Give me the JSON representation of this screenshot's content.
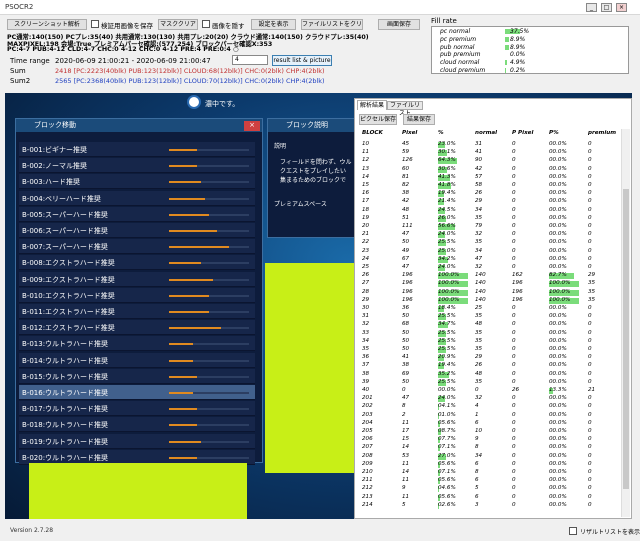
{
  "window": {
    "title": "PSOCR2",
    "min": "_",
    "max": "□",
    "close": "×"
  },
  "toolbar": {
    "analyze": "スクリーンショット解析",
    "save_verify": "検証用画像を保存",
    "mask_clear": "マスククリア",
    "hide_image": "画像を隠す",
    "show_settings": "設定を表示",
    "clear_filelist": "ファイルリストをクリア",
    "save_screen": "画面保存"
  },
  "info_lines": [
    "PC通常:140(150) PCプレ:35(40) 共用通常:130(130) 共用プレ:20(20) クラウド通常:140(150) クラウドプレ:35(40)",
    "MAXPIXEL:198 会場:True プレミアムパーセ確認:(577,254) ブロックパーセ確認X:353",
    "PC:4-7 PUB:4-12 CLD:4-7 CHC:0 4-12 CHC:0 4-12 PRE:4 PRE:0:4 ○"
  ],
  "time_range": {
    "label": "Time range",
    "value": "2020-06-09 21:00:21 - 2020-06-09 21:00:47",
    "input": "4",
    "button": "result list & picture"
  },
  "sum": {
    "label": "Sum",
    "value": "2418 [PC:2223(40blk) PUB:123(12blk)] CLOUD:68(12blk)] CHC:0(2blk) CHP:4(2blk)"
  },
  "sum2": {
    "label": "Sum2",
    "value": "2565 [PC:2368(40blk) PUB:123(12blk)] CLOUD:70(12blk)] CHC:0(2blk) CHP:4(2blk)"
  },
  "fill_rate": {
    "label": "Fill rate",
    "rows": [
      {
        "name": "pc normal",
        "pct": 37.5,
        "text": "37.5%"
      },
      {
        "name": "pc premium",
        "pct": 8.9,
        "text": "8.9%"
      },
      {
        "name": "pub normal",
        "pct": 8.9,
        "text": "8.9%"
      },
      {
        "name": "pub premium",
        "pct": 0.0,
        "text": "0.0%"
      },
      {
        "name": "cloud normal",
        "pct": 4.9,
        "text": "4.9%"
      },
      {
        "name": "cloud premium",
        "pct": 0.2,
        "text": "0.2%"
      }
    ]
  },
  "game": {
    "notice": "濃中です。",
    "block_panel_title": "ブロック移動",
    "desc_panel_title": "ブロック説明",
    "desc_header": "説明",
    "desc_text": [
      "フィールドを問わず、ウル",
      "クエストをプレイしたい",
      "集まるためのブロックで"
    ],
    "premium_space": "プレミアムスペース",
    "blocks": [
      {
        "label": "B-001:ビギナー推奨",
        "level": 0.35
      },
      {
        "label": "B-002:ノーマル推奨",
        "level": 0.35
      },
      {
        "label": "B-003:ハード推奨",
        "level": 0.4
      },
      {
        "label": "B-004:ベリーハード推奨",
        "level": 0.45
      },
      {
        "label": "B-005:スーパーハード推奨",
        "level": 0.5
      },
      {
        "label": "B-006:スーパーハード推奨",
        "level": 0.6
      },
      {
        "label": "B-007:スーパーハード推奨",
        "level": 0.75
      },
      {
        "label": "B-008:エクストラハード推奨",
        "level": 0.4
      },
      {
        "label": "B-009:エクストラハード推奨",
        "level": 0.55
      },
      {
        "label": "B-010:エクストラハード推奨",
        "level": 0.5
      },
      {
        "label": "B-011:エクストラハード推奨",
        "level": 0.5
      },
      {
        "label": "B-012:エクストラハード推奨",
        "level": 0.65
      },
      {
        "label": "B-013:ウルトラハード推奨",
        "level": 0.3
      },
      {
        "label": "B-014:ウルトラハード推奨",
        "level": 0.3
      },
      {
        "label": "B-015:ウルトラハード推奨",
        "level": 0.35
      },
      {
        "label": "B-016:ウルトラハード推奨",
        "level": 0.3
      },
      {
        "label": "B-017:ウルトラハード推奨",
        "level": 0.35
      },
      {
        "label": "B-018:ウルトラハード推奨",
        "level": 0.35
      },
      {
        "label": "B-019:ウルトラハード推奨",
        "level": 0.4
      },
      {
        "label": "B-020:ウルトラハード推奨",
        "level": 0.35
      }
    ]
  },
  "results": {
    "tabs": [
      "解析結果",
      "ファイルリスト"
    ],
    "btn_save_pixel": "ピクセル保存",
    "btn_save_result": "結果保存",
    "headers": [
      "BLOCK",
      "Pixel",
      "%",
      "normal",
      "P Pixel",
      "P%",
      "premium"
    ],
    "rows": [
      [
        "10",
        "45",
        "23.0%",
        "31",
        "0",
        "00.0%",
        "0"
      ],
      [
        "11",
        "59",
        "30.1%",
        "41",
        "0",
        "00.0%",
        "0"
      ],
      [
        "12",
        "126",
        "64.3%",
        "90",
        "0",
        "00.0%",
        "0"
      ],
      [
        "13",
        "60",
        "30.6%",
        "42",
        "0",
        "00.0%",
        "0"
      ],
      [
        "14",
        "81",
        "41.3%",
        "57",
        "0",
        "00.0%",
        "0"
      ],
      [
        "15",
        "82",
        "41.8%",
        "58",
        "0",
        "00.0%",
        "0"
      ],
      [
        "16",
        "38",
        "19.4%",
        "26",
        "0",
        "00.0%",
        "0"
      ],
      [
        "17",
        "42",
        "21.4%",
        "29",
        "0",
        "00.0%",
        "0"
      ],
      [
        "18",
        "48",
        "24.5%",
        "34",
        "0",
        "00.0%",
        "0"
      ],
      [
        "19",
        "51",
        "26.0%",
        "35",
        "0",
        "00.0%",
        "0"
      ],
      [
        "20",
        "111",
        "56.6%",
        "79",
        "0",
        "00.0%",
        "0"
      ],
      [
        "21",
        "47",
        "24.0%",
        "32",
        "0",
        "00.0%",
        "0"
      ],
      [
        "22",
        "50",
        "25.5%",
        "35",
        "0",
        "00.0%",
        "0"
      ],
      [
        "23",
        "49",
        "25.0%",
        "34",
        "0",
        "00.0%",
        "0"
      ],
      [
        "24",
        "67",
        "34.2%",
        "47",
        "0",
        "00.0%",
        "0"
      ],
      [
        "25",
        "47",
        "24.0%",
        "32",
        "0",
        "00.0%",
        "0"
      ],
      [
        "26",
        "196",
        "100.0%",
        "140",
        "162",
        "82.7%",
        "29"
      ],
      [
        "27",
        "196",
        "100.0%",
        "140",
        "196",
        "100.0%",
        "35"
      ],
      [
        "28",
        "196",
        "100.0%",
        "140",
        "196",
        "100.0%",
        "35"
      ],
      [
        "29",
        "196",
        "100.0%",
        "140",
        "196",
        "100.0%",
        "35"
      ],
      [
        "30",
        "36",
        "18.4%",
        "25",
        "0",
        "00.0%",
        "0"
      ],
      [
        "31",
        "50",
        "25.5%",
        "35",
        "0",
        "00.0%",
        "0"
      ],
      [
        "32",
        "68",
        "34.7%",
        "48",
        "0",
        "00.0%",
        "0"
      ],
      [
        "33",
        "50",
        "25.5%",
        "35",
        "0",
        "00.0%",
        "0"
      ],
      [
        "34",
        "50",
        "25.5%",
        "35",
        "0",
        "00.0%",
        "0"
      ],
      [
        "35",
        "50",
        "25.5%",
        "35",
        "0",
        "00.0%",
        "0"
      ],
      [
        "36",
        "41",
        "20.9%",
        "29",
        "0",
        "00.0%",
        "0"
      ],
      [
        "37",
        "38",
        "19.4%",
        "26",
        "0",
        "00.0%",
        "0"
      ],
      [
        "38",
        "69",
        "35.2%",
        "48",
        "0",
        "00.0%",
        "0"
      ],
      [
        "39",
        "50",
        "25.5%",
        "35",
        "0",
        "00.0%",
        "0"
      ],
      [
        "40",
        "0",
        "00.0%",
        "0",
        "26",
        "13.3%",
        "21"
      ],
      [
        "201",
        "47",
        "24.0%",
        "32",
        "0",
        "00.0%",
        "0"
      ],
      [
        "202",
        "8",
        "04.1%",
        "4",
        "0",
        "00.0%",
        "0"
      ],
      [
        "203",
        "2",
        "01.0%",
        "1",
        "0",
        "00.0%",
        "0"
      ],
      [
        "204",
        "11",
        "05.6%",
        "6",
        "0",
        "00.0%",
        "0"
      ],
      [
        "205",
        "17",
        "08.7%",
        "10",
        "0",
        "00.0%",
        "0"
      ],
      [
        "206",
        "15",
        "07.7%",
        "9",
        "0",
        "00.0%",
        "0"
      ],
      [
        "207",
        "14",
        "07.1%",
        "8",
        "0",
        "00.0%",
        "0"
      ],
      [
        "208",
        "53",
        "27.0%",
        "34",
        "0",
        "00.0%",
        "0"
      ],
      [
        "209",
        "11",
        "05.6%",
        "6",
        "0",
        "00.0%",
        "0"
      ],
      [
        "210",
        "14",
        "07.1%",
        "8",
        "0",
        "00.0%",
        "0"
      ],
      [
        "211",
        "11",
        "05.6%",
        "6",
        "0",
        "00.0%",
        "0"
      ],
      [
        "212",
        "9",
        "04.6%",
        "5",
        "0",
        "00.0%",
        "0"
      ],
      [
        "213",
        "11",
        "05.6%",
        "6",
        "0",
        "00.0%",
        "0"
      ],
      [
        "214",
        "5",
        "02.6%",
        "3",
        "0",
        "00.0%",
        "0"
      ]
    ],
    "pct_values": [
      23.0,
      30.1,
      64.3,
      30.6,
      41.3,
      41.8,
      19.4,
      21.4,
      24.5,
      26.0,
      56.6,
      24.0,
      25.5,
      25.0,
      34.2,
      24.0,
      100,
      100,
      100,
      100,
      18.4,
      25.5,
      34.7,
      25.5,
      25.5,
      25.5,
      20.9,
      19.4,
      35.2,
      25.5,
      0,
      24.0,
      4.1,
      1.0,
      5.6,
      8.7,
      7.7,
      7.1,
      27.0,
      5.6,
      7.1,
      5.6,
      4.6,
      5.6,
      2.6
    ],
    "ppct_values": [
      0,
      0,
      0,
      0,
      0,
      0,
      0,
      0,
      0,
      0,
      0,
      0,
      0,
      0,
      0,
      0,
      82.7,
      100,
      100,
      100,
      0,
      0,
      0,
      0,
      0,
      0,
      0,
      0,
      0,
      0,
      13.3,
      0,
      0,
      0,
      0,
      0,
      0,
      0,
      0,
      0,
      0,
      0,
      0,
      0,
      0
    ]
  },
  "footer": {
    "version": "Version 2.7.28",
    "show_result_list": "リザルトリストを表示"
  }
}
